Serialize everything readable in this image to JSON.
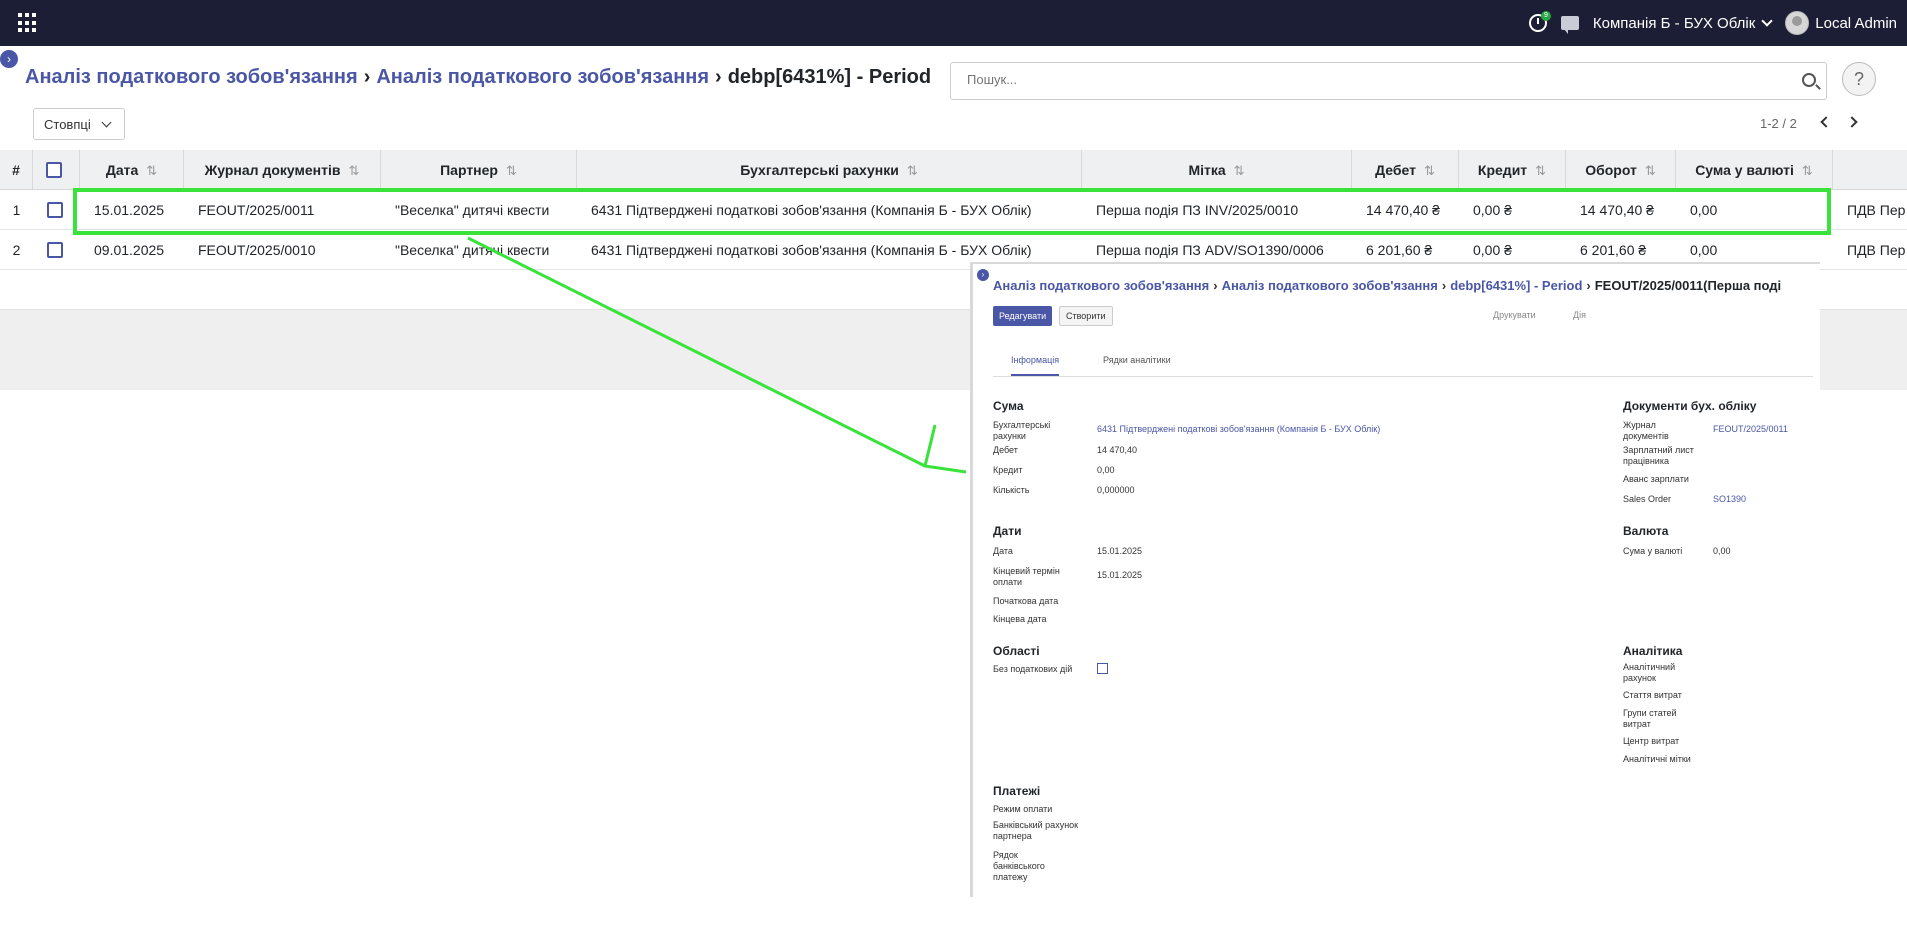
{
  "topbar": {
    "notification_count": "9",
    "company": "Компанія Б - БУХ Облік",
    "user": "Local Admin"
  },
  "breadcrumb": {
    "first": "Аналіз податкового зобов'язання",
    "second": "Аналіз податкового зобов'язання",
    "current": "debp[6431%] - Period"
  },
  "search": {
    "placeholder": "Пошук..."
  },
  "help_label": "?",
  "toolbar": {
    "columns_label": "Стовпці"
  },
  "pager": {
    "text": "1-2 / 2"
  },
  "table": {
    "headers": {
      "num": "#",
      "date": "Дата",
      "journal": "Журнал документів",
      "partner": "Партнер",
      "account": "Бухгалтерські рахунки",
      "label": "Мітка",
      "debit": "Дебет",
      "credit": "Кредит",
      "turnover": "Оборот",
      "currency_amount": "Сума у валюті"
    },
    "rows": [
      {
        "num": "1",
        "date": "15.01.2025",
        "journal": "FEOUT/2025/0011",
        "partner": "\"Веселка\" дитячі квести",
        "account": "6431 Підтверджені податкові зобов'язання (Компанія Б - БУХ Облік)",
        "label": "Перша подія ПЗ INV/2025/0010",
        "debit": "14 470,40 ₴",
        "credit": "0,00 ₴",
        "turnover": "14 470,40 ₴",
        "currency_amount": "0,00",
        "extra": "ПДВ Пер"
      },
      {
        "num": "2",
        "date": "09.01.2025",
        "journal": "FEOUT/2025/0010",
        "partner": "\"Веселка\" дитячі квести",
        "account": "6431 Підтверджені податкові зобов'язання (Компанія Б - БУХ Облік)",
        "label": "Перша подія ПЗ ADV/SO1390/0006",
        "debit": "6 201,60 ₴",
        "credit": "0,00 ₴",
        "turnover": "6 201,60 ₴",
        "currency_amount": "0,00",
        "extra": "ПДВ Пер"
      }
    ]
  },
  "inset": {
    "breadcrumb": {
      "first": "Аналіз податкового зобов'язання",
      "second": "Аналіз податкового зобов'язання",
      "third": "debp[6431%] - Period",
      "current": "FEOUT/2025/0011(Перша поді"
    },
    "edit_label": "Редагувати",
    "create_label": "Створити",
    "print_label": "Друкувати",
    "action_label": "Дія",
    "tabs": {
      "info": "Інформація",
      "analytics": "Рядки аналітики"
    },
    "amount": {
      "title": "Сума",
      "account_label": "Бухгалтерські рахунки",
      "account_value": "6431 Підтверджені податкові зобов'язання (Компанія Б - БУХ Облік)",
      "debit_label": "Дебет",
      "debit_value": "14 470,40",
      "credit_label": "Кредит",
      "credit_value": "0,00",
      "qty_label": "Кількість",
      "qty_value": "0,000000"
    },
    "docs": {
      "title": "Документи бух. обліку",
      "journal_label": "Журнал документів",
      "journal_value": "FEOUT/2025/0011",
      "payslip_label": "Зарплатний лист працівника",
      "advance_label": "Аванс зарплати",
      "sales_order_label": "Sales Order",
      "sales_order_value": "SO1390"
    },
    "dates": {
      "title": "Дати",
      "date_label": "Дата",
      "date_value": "15.01.2025",
      "due_label": "Кінцевий термін оплати",
      "due_value": "15.01.2025",
      "start_label": "Початкова дата",
      "end_label": "Кінцева дата"
    },
    "currency": {
      "title": "Валюта",
      "amount_label": "Сума у валюті",
      "amount_value": "0,00"
    },
    "areas": {
      "title": "Області",
      "no_tax_label": "Без податкових дій"
    },
    "analytics": {
      "title": "Аналітика",
      "account_label": "Аналітичний рахунок",
      "expense_item_label": "Стаття витрат",
      "expense_group_label": "Групи статей витрат",
      "cost_center_label": "Центр витрат",
      "tags_label": "Аналітичні мітки"
    },
    "payments": {
      "title": "Платежі",
      "mode_label": "Режим оплати",
      "bank_label": "Банківський рахунок партнера",
      "ref_label": "Рядок банківського платежу"
    }
  },
  "colors": {
    "navbar": "#1c1e35",
    "accent": "#4a56a6",
    "highlight": "#39e33a"
  }
}
